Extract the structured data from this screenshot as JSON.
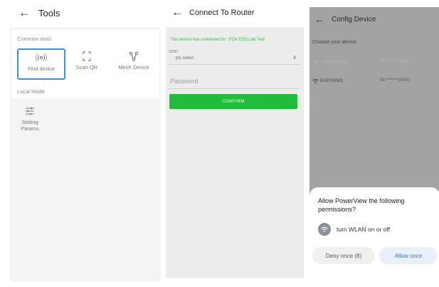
{
  "tools_screen": {
    "back_icon": "arrow-left-icon",
    "title": "Tools",
    "common_tools_label": "Common tools",
    "tools": [
      {
        "label": "Find device",
        "icon": "radar-icon",
        "selected": true
      },
      {
        "label": "Scan QR",
        "icon": "scan-frame-icon",
        "selected": false
      },
      {
        "label": "Mesh Device",
        "icon": "mesh-icon",
        "selected": false
      }
    ],
    "local_mode_label": "Local Mode",
    "setting": {
      "label": "Setting Params",
      "icon": "sliders-icon"
    }
  },
  "router_screen": {
    "back_icon": "arrow-left-icon",
    "title": "Connect To Router",
    "info": "This device has connected to : FOX ESS Lab Test",
    "ssid_label": "SSID",
    "ssid_select": "pls select",
    "password_placeholder": "Password",
    "confirm_label": "CONFIRM"
  },
  "config_screen": {
    "back_icon": "arrow-left-icon",
    "title": "Config Device",
    "choose_label": "Choose your device.",
    "devices": [
      {
        "name": "**-EAP(0052)",
        "id": "59-*******(0052)",
        "faint": true
      },
      {
        "name": "EAP(0050)",
        "id": "59-*******(0050)",
        "faint": false
      }
    ],
    "dialog": {
      "prompt": "Allow PowerView the following permissions?",
      "permission": "turn WLAN on or off",
      "deny_label": "Deny once (8)",
      "allow_label": "Allow once"
    }
  },
  "colors": {
    "accent_green": "#21bd3a",
    "info_green": "#38b24c",
    "selected_border": "#3d8fe0",
    "allow_text": "#3a74c9"
  }
}
